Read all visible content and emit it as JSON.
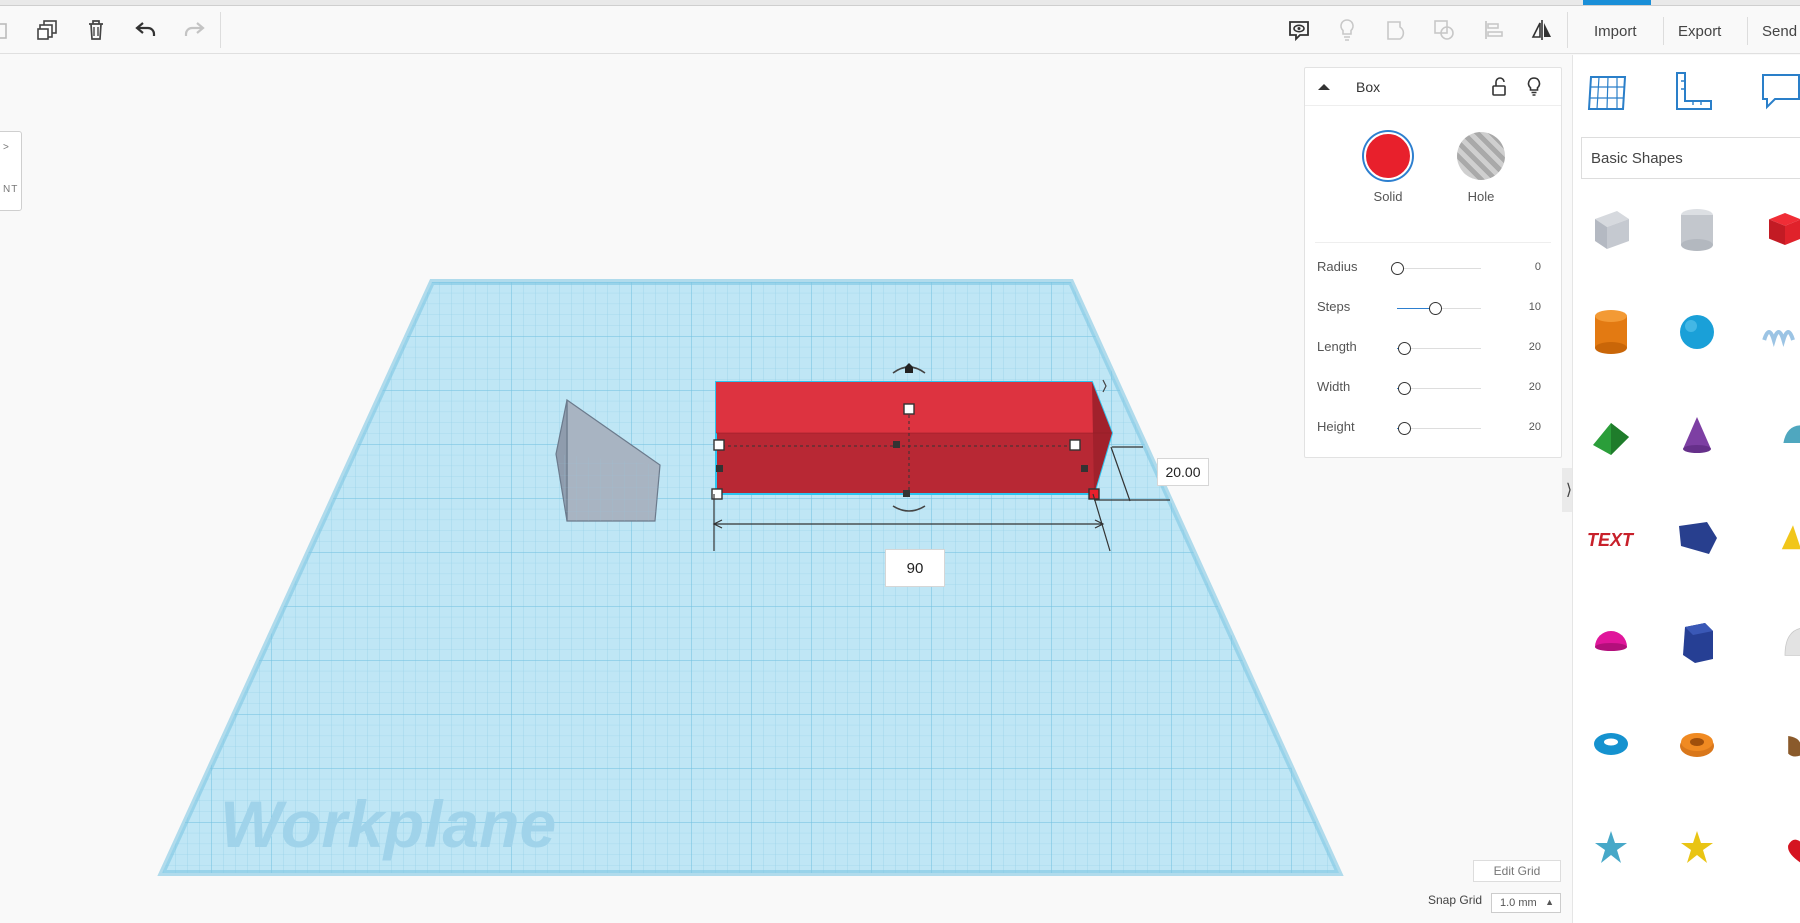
{
  "toolbar": {
    "import_label": "Import",
    "export_label": "Export",
    "send_label": "Send"
  },
  "viewport": {
    "workplane_label": "Workplane",
    "view_cube_face": "NT",
    "height_dimension": "20.00",
    "length_input_value": "90",
    "edit_grid_label": "Edit Grid",
    "snap_grid_label": "Snap Grid",
    "snap_grid_value": "1.0 mm"
  },
  "inspector": {
    "title": "Box",
    "modes": [
      {
        "label": "Solid",
        "selected": true,
        "color": "#e8202c"
      },
      {
        "label": "Hole",
        "selected": false
      }
    ],
    "params": [
      {
        "name": "Radius",
        "value": "0",
        "fraction": 0.0
      },
      {
        "name": "Steps",
        "value": "10",
        "fraction": 0.45
      },
      {
        "name": "Length",
        "value": "20",
        "fraction": 0.08
      },
      {
        "name": "Width",
        "value": "20",
        "fraction": 0.08
      },
      {
        "name": "Height",
        "value": "20",
        "fraction": 0.08
      }
    ]
  },
  "shapes_panel": {
    "category": "Basic Shapes",
    "shapes": [
      "box-hole",
      "cylinder-hole",
      "box-red",
      "cylinder-orange",
      "sphere-blue",
      "scribble",
      "roof-green",
      "cone-purple",
      "round-roof",
      "text-red",
      "wedge-navy",
      "pyramid-yellow",
      "half-sphere-magenta",
      "polygon-navy",
      "paraboloid-gray",
      "torus-blue",
      "tube-orange",
      "ring-brown",
      "star-teal",
      "star-yellow",
      "heart-red"
    ]
  },
  "colors": {
    "accent": "#2d7fcf",
    "solid_red": "#e8202c",
    "grid_blue": "#a9dcef"
  }
}
